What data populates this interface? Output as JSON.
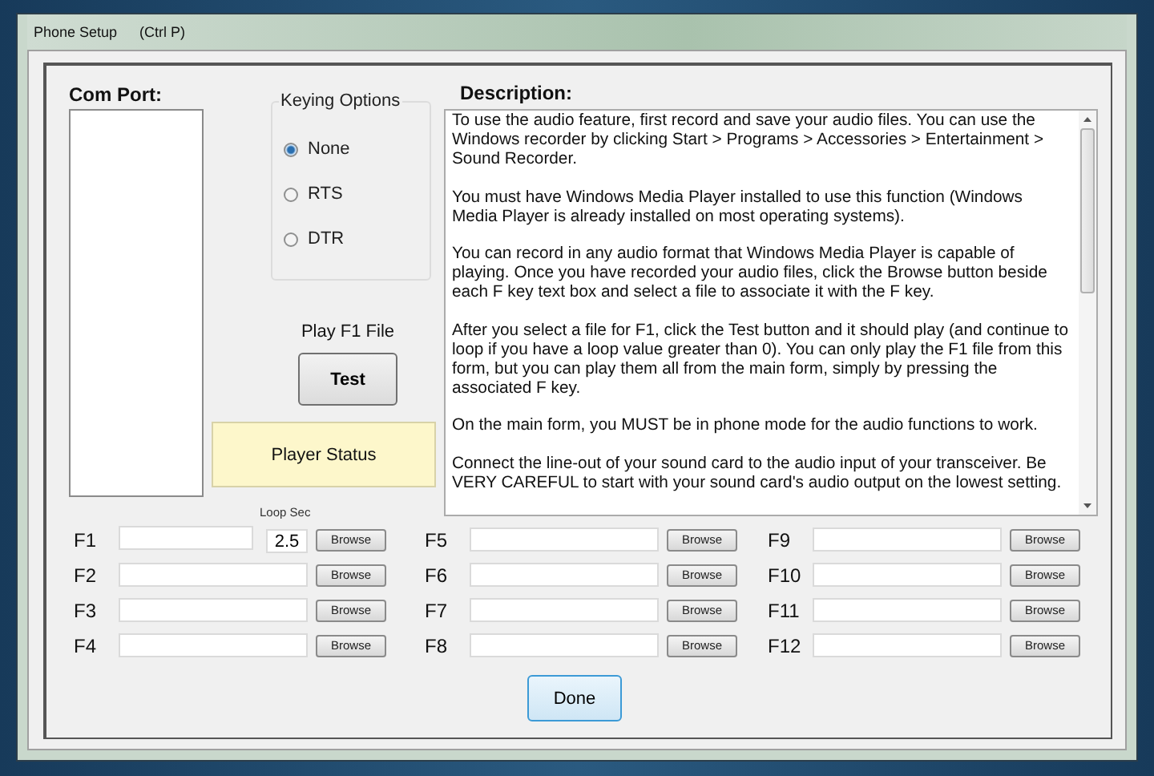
{
  "window": {
    "title": "Phone Setup",
    "shortcut": "(Ctrl P)"
  },
  "com_port": {
    "label": "Com Port:"
  },
  "keying_options": {
    "title": "Keying Options",
    "options": [
      {
        "label": "None",
        "selected": true
      },
      {
        "label": "RTS",
        "selected": false
      },
      {
        "label": "DTR",
        "selected": false
      }
    ]
  },
  "play_label": "Play F1 File",
  "test_button": "Test",
  "player_status": "Player Status",
  "description": {
    "label": "Description:",
    "paragraphs": [
      "To use the audio feature, first record and save your audio files.  You can use the Windows recorder by clicking Start > Programs > Accessories > Entertainment > Sound Recorder.",
      "You must have Windows Media Player installed to use this function (Windows Media Player is already installed on most operating systems).",
      "You can record in any audio format that Windows Media Player is capable of playing. Once you have recorded your audio files, click the Browse button beside each F key text box and select a file to associate it with the F key.",
      "After you select a file for F1, click the Test button and it should play (and continue to loop if you have a loop value greater than 0).  You can only play the F1 file from this form, but you can play them all from the main form, simply by pressing the associated F key.",
      "On the main form, you MUST be in phone mode for the audio functions to work.",
      "Connect the line-out of your sound card to the audio input of your transceiver.  Be VERY CAREFUL to start with your sound card's audio output on the lowest setting."
    ]
  },
  "fkeys": [
    {
      "label": "F1",
      "browse": "Browse",
      "loop": {
        "label": "Loop Sec",
        "value": "2.5"
      }
    },
    {
      "label": "F2",
      "browse": "Browse"
    },
    {
      "label": "F3",
      "browse": "Browse"
    },
    {
      "label": "F4",
      "browse": "Browse"
    },
    {
      "label": "F5",
      "browse": "Browse"
    },
    {
      "label": "F6",
      "browse": "Browse"
    },
    {
      "label": "F7",
      "browse": "Browse"
    },
    {
      "label": "F8",
      "browse": "Browse"
    },
    {
      "label": "F9",
      "browse": "Browse"
    },
    {
      "label": "F10",
      "browse": "Browse"
    },
    {
      "label": "F11",
      "browse": "Browse"
    },
    {
      "label": "F12",
      "browse": "Browse"
    }
  ],
  "done_button": "Done"
}
